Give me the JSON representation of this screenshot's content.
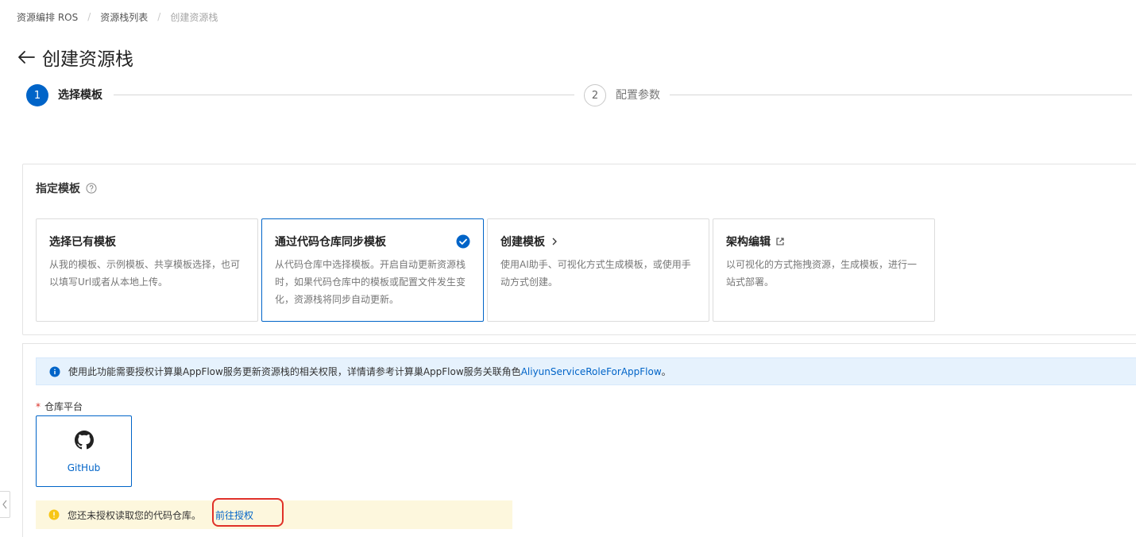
{
  "breadcrumb": {
    "items": [
      "资源编排 ROS",
      "资源栈列表",
      "创建资源栈"
    ],
    "separator": "/"
  },
  "page": {
    "title": "创建资源栈"
  },
  "steps": [
    {
      "number": "1",
      "label": "选择模板",
      "state": "active"
    },
    {
      "number": "2",
      "label": "配置参数",
      "state": "inactive"
    }
  ],
  "template_panel": {
    "title": "指定模板",
    "cards": [
      {
        "title": "选择已有模板",
        "desc": "从我的模板、示例模板、共享模板选择，也可以填写Url或者从本地上传。",
        "selected": false,
        "icon": ""
      },
      {
        "title": "通过代码仓库同步模板",
        "desc": "从代码仓库中选择模板。开启自动更新资源栈时，如果代码仓库中的模板或配置文件发生变化，资源栈将同步自动更新。",
        "selected": true,
        "icon": "check-circle-icon"
      },
      {
        "title": "创建模板",
        "desc": "使用AI助手、可视化方式生成模板，或使用手动方式创建。",
        "selected": false,
        "icon": "chevron-right-icon"
      },
      {
        "title": "架构编辑",
        "desc": "以可视化的方式拖拽资源，生成模板，进行一站式部署。",
        "selected": false,
        "icon": "external-link-icon"
      }
    ]
  },
  "repo_panel": {
    "info_text": "使用此功能需要授权计算巢AppFlow服务更新资源栈的相关权限，详情请参考计算巢AppFlow服务关联角色",
    "info_link": "AliyunServiceRoleForAppFlow",
    "info_suffix": "。",
    "field_label": "仓库平台",
    "required_mark": "*",
    "platform": {
      "label": "GitHub",
      "icon": "github-icon"
    },
    "warning_text": "您还未授权读取您的代码仓库。",
    "warning_link": "前往授权"
  },
  "colors": {
    "primary": "#0064c8",
    "info_bg": "#e6f2fd",
    "warning_bg": "#fdf7dd",
    "warning_icon": "#f7c615",
    "highlight": "#e03128",
    "required": "#d93026"
  }
}
